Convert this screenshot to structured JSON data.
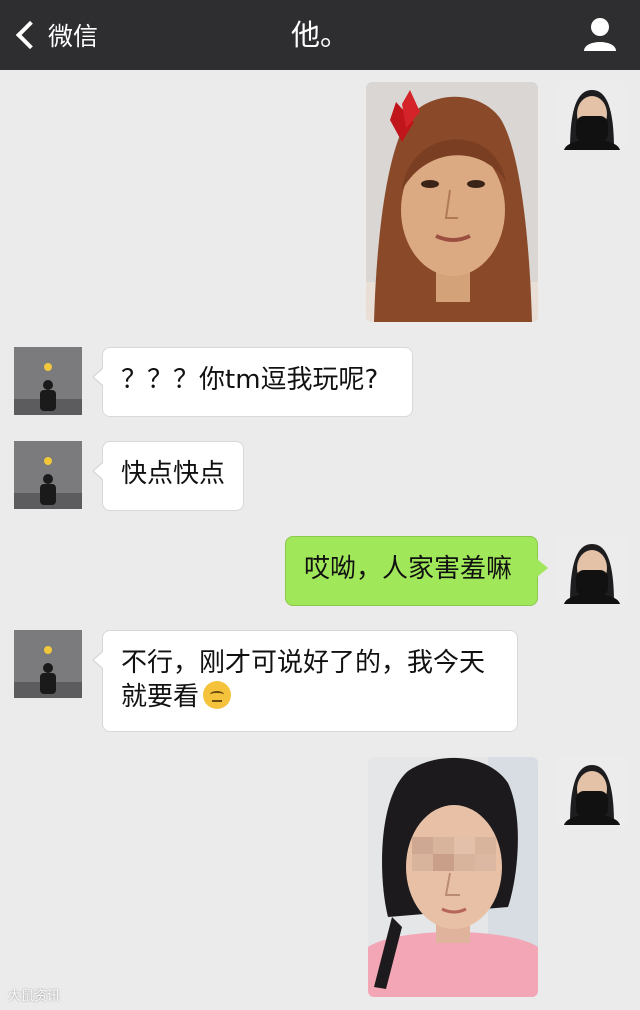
{
  "navbar": {
    "back_label": "微信",
    "title": "他。",
    "icons": {
      "back": "chevron-left-icon",
      "profile": "person-icon"
    }
  },
  "messages": [
    {
      "side": "right",
      "type": "image",
      "description": "selfie photo"
    },
    {
      "side": "left",
      "type": "text",
      "text": "？？？你tm逗我玩呢?"
    },
    {
      "side": "left",
      "type": "text",
      "text": "快点快点"
    },
    {
      "side": "right",
      "type": "text",
      "text": "哎呦，人家害羞嘛"
    },
    {
      "side": "left",
      "type": "text",
      "text_line1": "不行，刚才可说好了的，我今天",
      "text_line2": "就要看",
      "emoji": "thinking-face-emoji"
    },
    {
      "side": "right",
      "type": "image",
      "description": "selfie photo"
    }
  ],
  "watermark": "大鼠资讯",
  "colors": {
    "navbar": "#2e2e31",
    "background": "#ebebeb",
    "bubble_incoming": "#ffffff",
    "bubble_outgoing": "#a0e75a"
  }
}
